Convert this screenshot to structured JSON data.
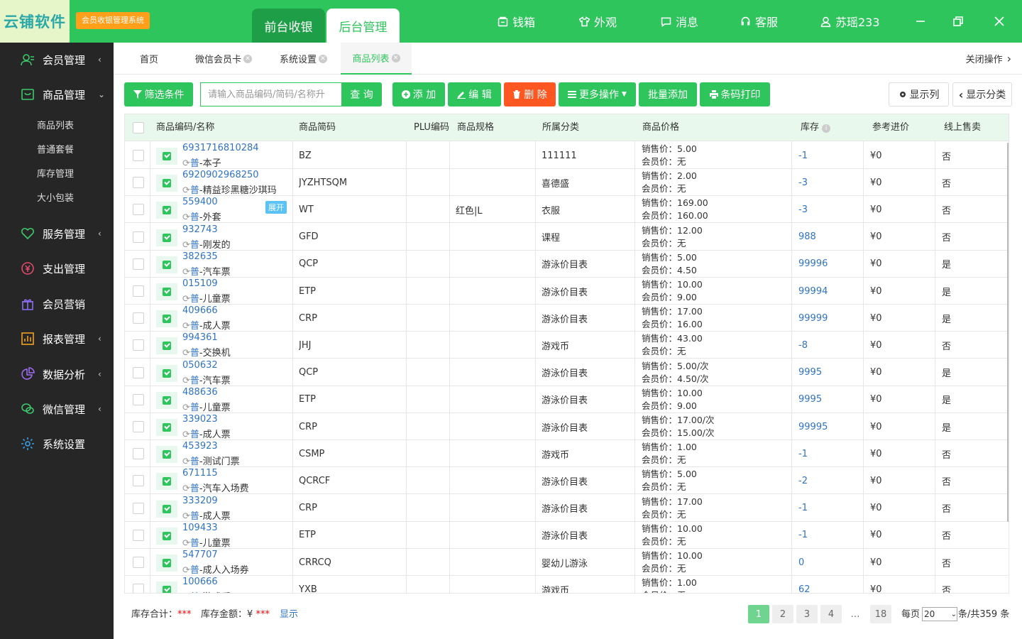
{
  "app": {
    "logo": "云铺软件",
    "system_badge": "会员收银管理系统"
  },
  "top_tabs": [
    "前台收银",
    "后台管理"
  ],
  "top_nav": {
    "cash_box": "钱箱",
    "appearance": "外观",
    "messages": "消息",
    "service": "客服",
    "user": "苏瑶233"
  },
  "sidebar": {
    "items": [
      {
        "label": "会员管理",
        "icon": "members-icon",
        "arrow": "‹"
      },
      {
        "label": "商品管理",
        "icon": "goods-icon",
        "arrow": "⌄"
      },
      {
        "label": "服务管理",
        "icon": "service-icon",
        "arrow": "‹"
      },
      {
        "label": "支出管理",
        "icon": "expense-icon",
        "arrow": ""
      },
      {
        "label": "会员营销",
        "icon": "gift-icon",
        "arrow": ""
      },
      {
        "label": "报表管理",
        "icon": "report-icon",
        "arrow": "‹"
      },
      {
        "label": "数据分析",
        "icon": "pie-icon",
        "arrow": "‹"
      },
      {
        "label": "微信管理",
        "icon": "wechat-icon",
        "arrow": "‹"
      },
      {
        "label": "系统设置",
        "icon": "settings-icon",
        "arrow": ""
      }
    ],
    "subitems": [
      "商品列表",
      "普通套餐",
      "库存管理",
      "大小包装"
    ]
  },
  "page_tabs": [
    "首页",
    "微信会员卡",
    "系统设置",
    "商品列表"
  ],
  "close_ops": "关闭操作",
  "toolbar": {
    "filter": "筛选条件",
    "search_placeholder": "请输入商品编码/简码/名称升",
    "query": "查 询",
    "add": "添 加",
    "edit": "编 辑",
    "delete": "删 除",
    "more": "更多操作",
    "batch_add": "批量添加",
    "barcode_print": "条码打印",
    "show_columns": "显示列",
    "show_category": "显示分类"
  },
  "table": {
    "headers": [
      "商品编码/名称",
      "商品简码",
      "PLU编码",
      "商品规格",
      "所属分类",
      "商品价格",
      "库存",
      "参考进价",
      "线上售卖"
    ],
    "price_labels": {
      "sale": "销售价：",
      "member": "会员价："
    },
    "type_tag": "普",
    "expand_label": "展开",
    "rows": [
      {
        "code": "6931716810284",
        "name": "本子",
        "short": "BZ",
        "spec": "",
        "cat": "111111",
        "sale": "5.00",
        "member": "无",
        "stock": "-1",
        "cost": "¥0",
        "online": "否"
      },
      {
        "code": "6920902968250",
        "name": "精益珍黑糖沙琪玛",
        "short": "JYZHTSQM",
        "spec": "",
        "cat": "喜德盛",
        "sale": "2.00",
        "member": "无",
        "stock": "-3",
        "cost": "¥0",
        "online": "否"
      },
      {
        "code": "559400",
        "name": "外套",
        "short": "WT",
        "spec": "红色|L",
        "cat": "衣服",
        "sale": "169.00",
        "member": "160.00",
        "stock": "-3",
        "cost": "¥0",
        "online": "否"
      },
      {
        "code": "932743",
        "name": "刚发的",
        "short": "GFD",
        "spec": "",
        "cat": "课程",
        "sale": "12.00",
        "member": "无",
        "stock": "988",
        "cost": "¥0",
        "online": "否"
      },
      {
        "code": "382635",
        "name": "汽车票",
        "short": "QCP",
        "spec": "",
        "cat": "游泳价目表",
        "sale": "5.00",
        "member": "4.50",
        "stock": "99996",
        "cost": "¥0",
        "online": "是"
      },
      {
        "code": "015109",
        "name": "儿童票",
        "short": "ETP",
        "spec": "",
        "cat": "游泳价目表",
        "sale": "10.00",
        "member": "9.00",
        "stock": "99994",
        "cost": "¥0",
        "online": "是"
      },
      {
        "code": "409666",
        "name": "成人票",
        "short": "CRP",
        "spec": "",
        "cat": "游泳价目表",
        "sale": "17.00",
        "member": "16.00",
        "stock": "99999",
        "cost": "¥0",
        "online": "是"
      },
      {
        "code": "994361",
        "name": "交换机",
        "short": "JHJ",
        "spec": "",
        "cat": "游戏币",
        "sale": "43.00",
        "member": "无",
        "stock": "-8",
        "cost": "¥0",
        "online": "否"
      },
      {
        "code": "050632",
        "name": "汽车票",
        "short": "QCP",
        "spec": "",
        "cat": "游泳价目表",
        "sale": "5.00/次",
        "member": "4.50/次",
        "stock": "9995",
        "cost": "¥0",
        "online": "是"
      },
      {
        "code": "488636",
        "name": "儿童票",
        "short": "ETP",
        "spec": "",
        "cat": "游泳价目表",
        "sale": "10.00",
        "member": "9.00",
        "stock": "9995",
        "cost": "¥0",
        "online": "是"
      },
      {
        "code": "339023",
        "name": "成人票",
        "short": "CRP",
        "spec": "",
        "cat": "游泳价目表",
        "sale": "17.00/次",
        "member": "15.00/次",
        "stock": "99995",
        "cost": "¥0",
        "online": "是"
      },
      {
        "code": "453923",
        "name": "测试门票",
        "short": "CSMP",
        "spec": "",
        "cat": "游戏币",
        "sale": "1.00",
        "member": "无",
        "stock": "-1",
        "cost": "¥0",
        "online": "否"
      },
      {
        "code": "671115",
        "name": "汽车入场费",
        "short": "QCRCF",
        "spec": "",
        "cat": "游泳价目表",
        "sale": "5.00",
        "member": "无",
        "stock": "-2",
        "cost": "¥0",
        "online": "否"
      },
      {
        "code": "333209",
        "name": "成人票",
        "short": "CRP",
        "spec": "",
        "cat": "游泳价目表",
        "sale": "17.00",
        "member": "无",
        "stock": "-1",
        "cost": "¥0",
        "online": "否"
      },
      {
        "code": "109433",
        "name": "儿童票",
        "short": "ETP",
        "spec": "",
        "cat": "游泳价目表",
        "sale": "10.00",
        "member": "无",
        "stock": "-1",
        "cost": "¥0",
        "online": "否"
      },
      {
        "code": "547707",
        "name": "成人入场券",
        "short": "CRRCQ",
        "spec": "",
        "cat": "婴幼儿游泳",
        "sale": "10.00",
        "member": "无",
        "stock": "0",
        "cost": "¥0",
        "online": "否"
      },
      {
        "code": "100666",
        "name": "游戏币",
        "short": "YXB",
        "spec": "",
        "cat": "游戏币",
        "sale": "1.00",
        "member": "无",
        "stock": "62",
        "cost": "¥0",
        "online": "否"
      }
    ]
  },
  "footer": {
    "stock_total_label": "库存合计：",
    "stock_total": "***",
    "stock_amount_label": "库存金额：",
    "currency": "¥",
    "stock_amount": "***",
    "show": "显示",
    "pages": [
      "1",
      "2",
      "3",
      "4",
      "…",
      "18"
    ],
    "per_page_label": "每页",
    "per_page": "20",
    "total": "条/共359 条"
  },
  "colors": {
    "brand": "#2ec55c",
    "danger": "#ff5722",
    "link": "#2f73c4",
    "sidebar": "#262626"
  }
}
